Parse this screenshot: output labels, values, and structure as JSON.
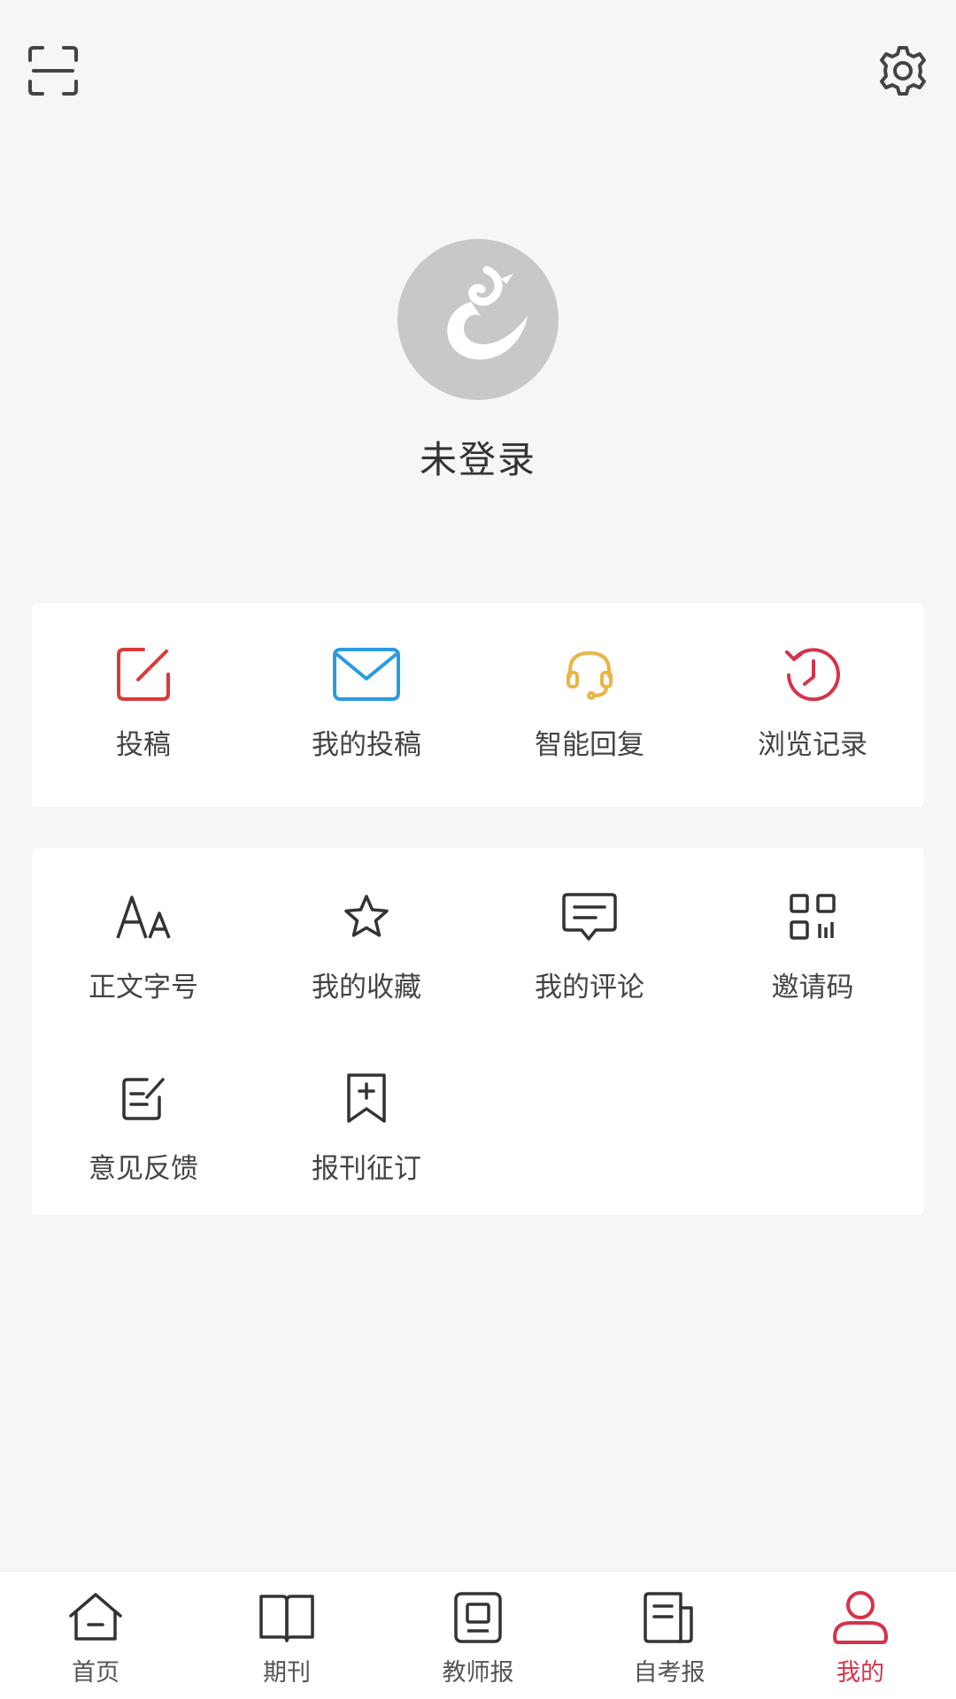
{
  "header": {
    "scan_icon": "scan-icon",
    "settings_icon": "gear-icon"
  },
  "profile": {
    "status": "未登录"
  },
  "quick_actions": [
    {
      "label": "投稿",
      "icon": "edit-square-icon",
      "color": "#d93a3a"
    },
    {
      "label": "我的投稿",
      "icon": "mail-icon",
      "color": "#2a9be0"
    },
    {
      "label": "智能回复",
      "icon": "headset-icon",
      "color": "#e8b547"
    },
    {
      "label": "浏览记录",
      "icon": "history-clock-icon",
      "color": "#d6334a"
    }
  ],
  "tools": [
    {
      "label": "正文字号",
      "icon": "font-size-icon"
    },
    {
      "label": "我的收藏",
      "icon": "star-icon"
    },
    {
      "label": "我的评论",
      "icon": "comment-icon"
    },
    {
      "label": "邀请码",
      "icon": "qr-code-icon"
    },
    {
      "label": "意见反馈",
      "icon": "feedback-icon"
    },
    {
      "label": "报刊征订",
      "icon": "bookmark-add-icon"
    }
  ],
  "bottom_nav": [
    {
      "label": "首页",
      "icon": "home-icon"
    },
    {
      "label": "期刊",
      "icon": "book-icon"
    },
    {
      "label": "教师报",
      "icon": "newspaper-icon"
    },
    {
      "label": "自考报",
      "icon": "document-icon"
    },
    {
      "label": "我的",
      "icon": "user-icon",
      "active": true
    }
  ],
  "colors": {
    "accent": "#d6334a",
    "background": "#f6f6f6",
    "card": "#ffffff",
    "avatar_bg": "#c8c8c8"
  }
}
